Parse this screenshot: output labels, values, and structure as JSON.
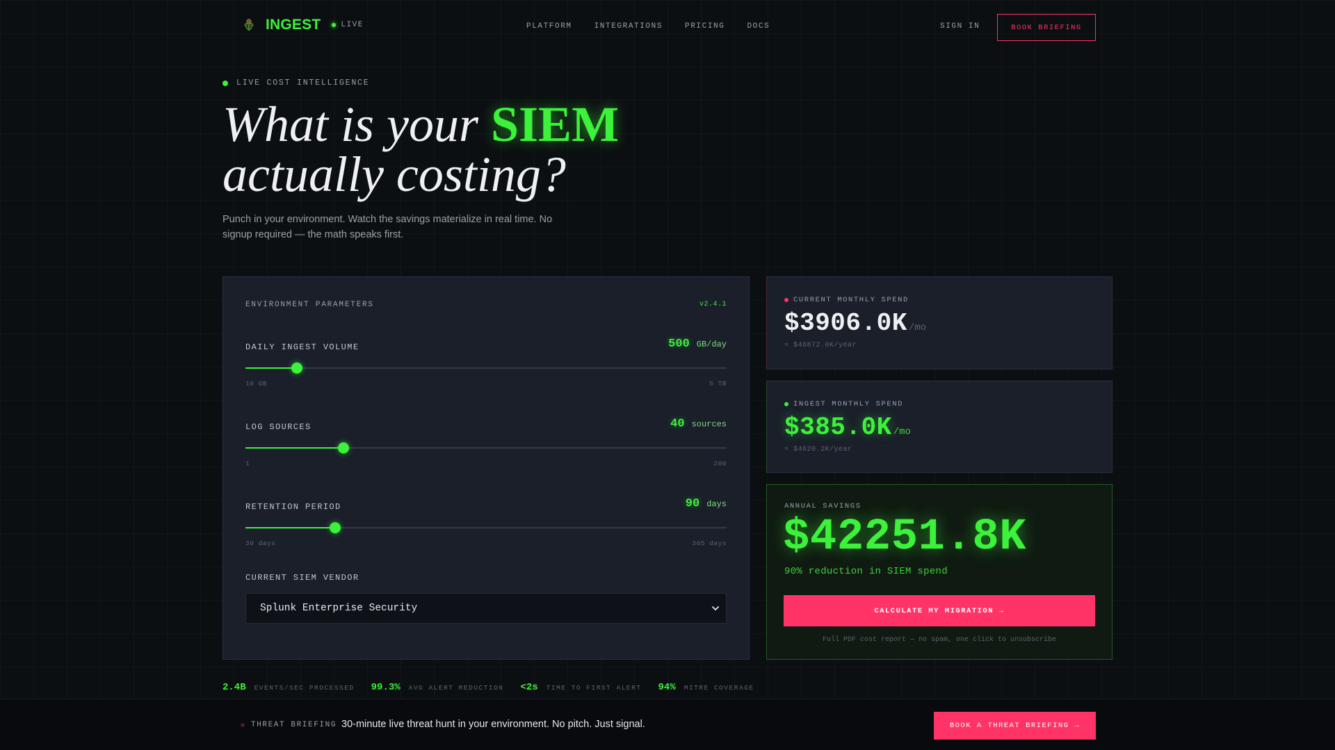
{
  "nav": {
    "brand": "INGEST",
    "live_label": "LIVE",
    "links": [
      "PLATFORM",
      "INTEGRATIONS",
      "PRICING",
      "DOCS"
    ],
    "sign_in": "SIGN IN",
    "book_label": "BOOK BRIEFING"
  },
  "hero": {
    "eyebrow": "LIVE COST INTELLIGENCE",
    "headline_pre": "What is your",
    "headline_accent": "SIEM",
    "headline_line2": "actually costing?",
    "subtext": "Punch in your environment. Watch the savings materialize in real time. No signup required — the math speaks first."
  },
  "params": {
    "title": "ENVIRONMENT PARAMETERS",
    "version": "v2.4.1",
    "ingest": {
      "label": "DAILY INGEST VOLUME",
      "value": "500",
      "unit": "GB/day",
      "min": "10 GB",
      "max": "5 TB",
      "fill_fraction": 0.107
    },
    "sources": {
      "label": "LOG SOURCES",
      "value": "40",
      "unit": "sources",
      "min": "1",
      "max": "200",
      "fill_fraction": 0.204
    },
    "retention": {
      "label": "RETENTION PERIOD",
      "value": "90",
      "unit": "days",
      "min": "30 days",
      "max": "365 days",
      "fill_fraction": 0.186
    },
    "vendor_label": "CURRENT SIEM VENDOR",
    "vendor_value": "Splunk Enterprise Security"
  },
  "current": {
    "label": "CURRENT MONTHLY SPEND",
    "amount": "$3906.0K",
    "period": "/mo",
    "yearly": "≈ $46872.0K/year"
  },
  "ingest": {
    "label": "INGEST MONTHLY SPEND",
    "amount": "$385.0K",
    "period": "/mo",
    "yearly": "≈ $4620.2K/year"
  },
  "savings": {
    "label": "ANNUAL SAVINGS",
    "amount": "$42251.8K",
    "reduction": "90% reduction in SIEM spend",
    "cta": "CALCULATE MY MIGRATION →",
    "fine": "Full PDF cost report — no spam, one click to unsubscribe"
  },
  "stats": [
    {
      "value": "2.4B",
      "label": "EVENTS/SEC PROCESSED"
    },
    {
      "value": "99.3%",
      "label": "AVG ALERT REDUCTION"
    },
    {
      "value": "<2s",
      "label": "TIME TO FIRST ALERT"
    },
    {
      "value": "94%",
      "label": "MITRE COVERAGE"
    }
  ],
  "bottom": {
    "label": "THREAT BRIEFING",
    "text": "30-minute live threat hunt in your environment. No pitch. Just signal.",
    "button": "BOOK A THREAT BRIEFING →"
  },
  "colors": {
    "accent_green": "#3cf23a",
    "accent_pink": "#ff3366",
    "background": "#0c0f12",
    "panel": "#1a1f2a"
  },
  "icons": {
    "logo": "shield-bug-icon",
    "select": "chevron-down-icon"
  }
}
